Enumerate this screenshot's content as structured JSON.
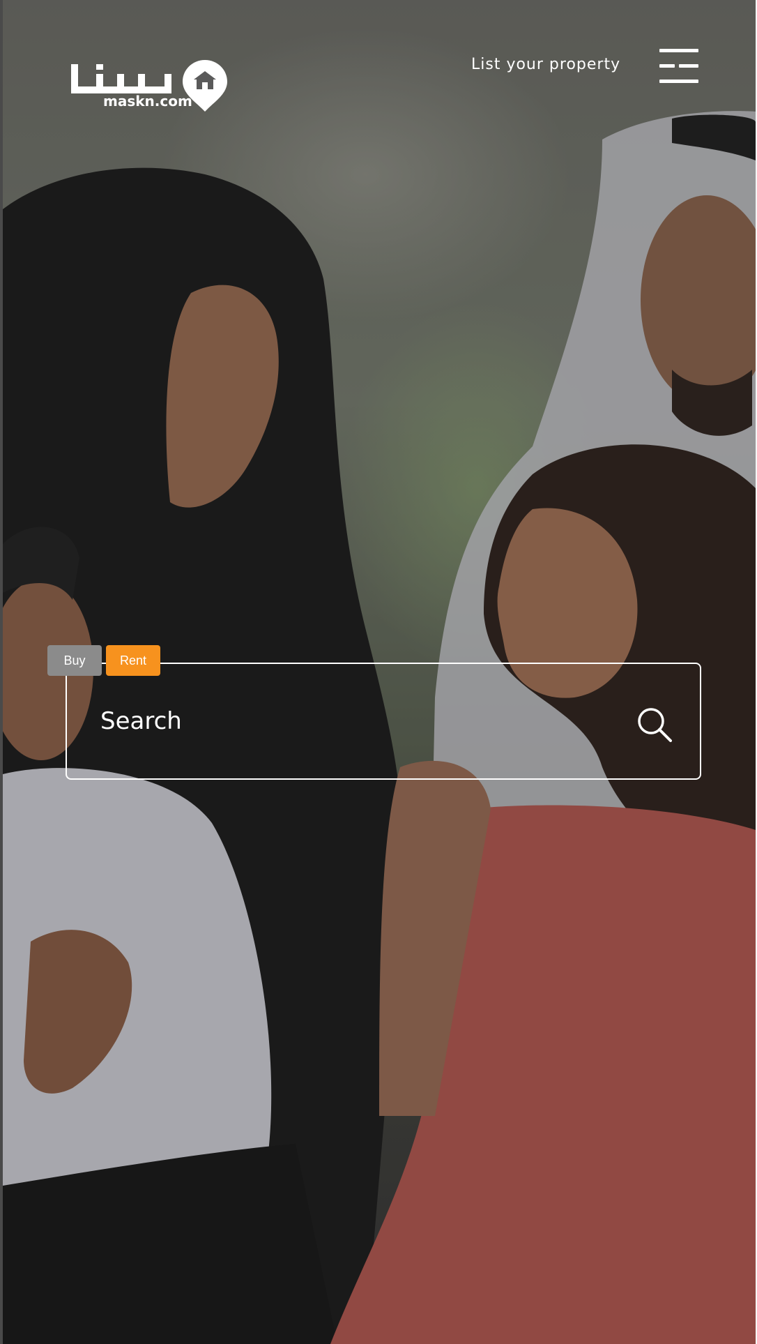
{
  "header": {
    "logo_text": "maskn.com",
    "list_property_label": "List your property"
  },
  "search": {
    "placeholder": "Search",
    "tabs": [
      {
        "label": "Buy",
        "active": false
      },
      {
        "label": "Rent",
        "active": true
      }
    ]
  },
  "colors": {
    "accent": "#f7921e",
    "inactive_tab": "#8b8b8b",
    "text": "#ffffff"
  },
  "icons": {
    "menu": "hamburger-menu-icon",
    "search": "search-icon",
    "logo_pin": "location-pin-icon"
  }
}
